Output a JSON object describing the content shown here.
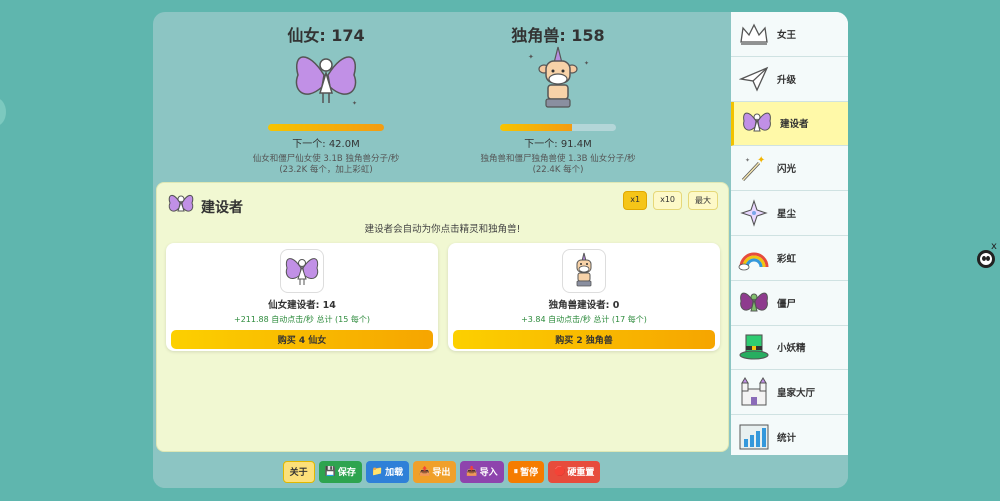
{
  "fairy_counter": {
    "title": "仙女: 174",
    "next": "下一个: 42.0M",
    "rate_line1": "仙女和僵尸仙女使 3.1B 独角兽分子/秒",
    "rate_line2": "(23.2K 每个，加上彩虹)",
    "progress": 1.0
  },
  "unicorn_counter": {
    "title": "独角兽: 158",
    "next": "下一个: 91.4M",
    "rate_line1": "独角兽和僵尸独角兽使 1.3B 仙女分子/秒",
    "rate_line2": "(22.4K 每个)",
    "progress": 0.62
  },
  "panel": {
    "title": "建设者",
    "description": "建设者会自动为你点击精灵和独角兽!",
    "multipliers": [
      "x1",
      "x10",
      "最大"
    ],
    "cards": [
      {
        "name": "仙女建设者: 14",
        "gain": "+211.88 自动点击/秒 总计 (15 每个)",
        "buy": "购买 4 仙女"
      },
      {
        "name": "独角兽建设者: 0",
        "gain": "+3.84 自动点击/秒 总计 (17 每个)",
        "buy": "购买 2 独角兽"
      }
    ]
  },
  "sidebar": {
    "items": [
      {
        "label": "女王",
        "icon": "crown-icon"
      },
      {
        "label": "升级",
        "icon": "paper-plane-icon"
      },
      {
        "label": "建设者",
        "icon": "fairy-icon"
      },
      {
        "label": "闪光",
        "icon": "magic-wand-icon"
      },
      {
        "label": "星尘",
        "icon": "star-dust-icon"
      },
      {
        "label": "彩虹",
        "icon": "rainbow-icon"
      },
      {
        "label": "僵尸",
        "icon": "zombie-fairy-icon"
      },
      {
        "label": "小妖精",
        "icon": "leprechaun-hat-icon"
      },
      {
        "label": "皇家大厅",
        "icon": "castle-icon"
      },
      {
        "label": "统计",
        "icon": "stats-icon"
      }
    ]
  },
  "footer": {
    "about": "关于",
    "save": "保存",
    "load": "加载",
    "export": "导出",
    "import": "导入",
    "pause": "暂停",
    "hard_reset": "硬重置"
  },
  "colors": {
    "background": "#5fb6ae",
    "panel": "#f1f8d2",
    "accent": "#f5c518",
    "active_tab": "#fff9a8"
  }
}
